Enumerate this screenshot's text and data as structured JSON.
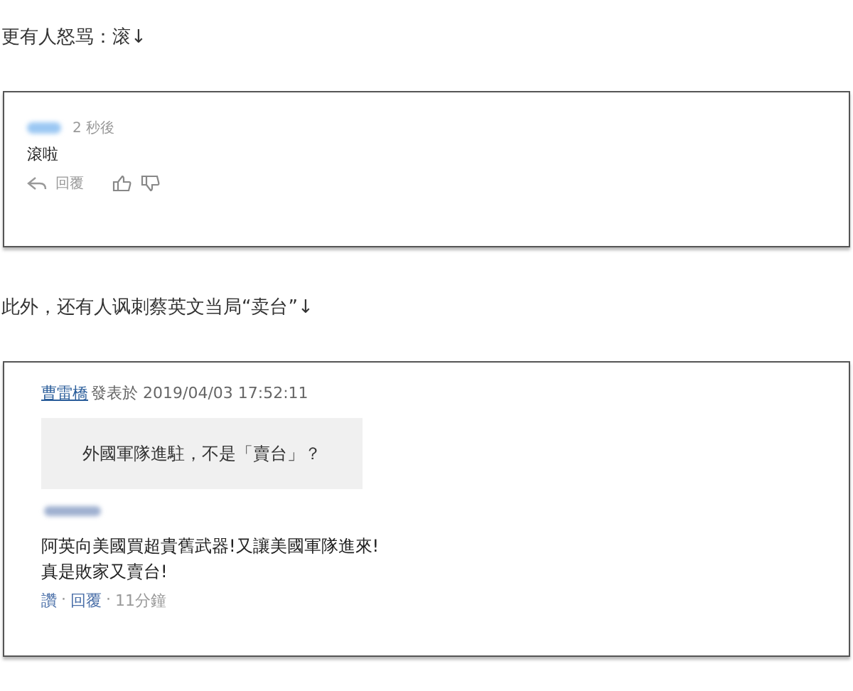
{
  "caption_1": "更有人怒骂：滚↓",
  "comment_1": {
    "time": "2 秒後",
    "text": "滾啦",
    "reply": "回覆"
  },
  "caption_2": "此外，还有人讽刺蔡英文当局“卖台”↓",
  "comment_2": {
    "author": "曹雷橋",
    "posted": "發表於 2019/04/03 17:52:11",
    "quote": "外國軍隊進駐，不是「賣台」？",
    "reply_lines": [
      "阿英向美國買超貴舊武器!又讓美國軍隊進來!",
      "真是敗家又賣台!"
    ],
    "actions": [
      {
        "kind": "link",
        "label": "讚"
      },
      {
        "kind": "sep",
        "label": "·"
      },
      {
        "kind": "link",
        "label": "回覆"
      },
      {
        "kind": "sep",
        "label": "·"
      },
      {
        "kind": "time",
        "label": "11分鐘"
      }
    ]
  }
}
